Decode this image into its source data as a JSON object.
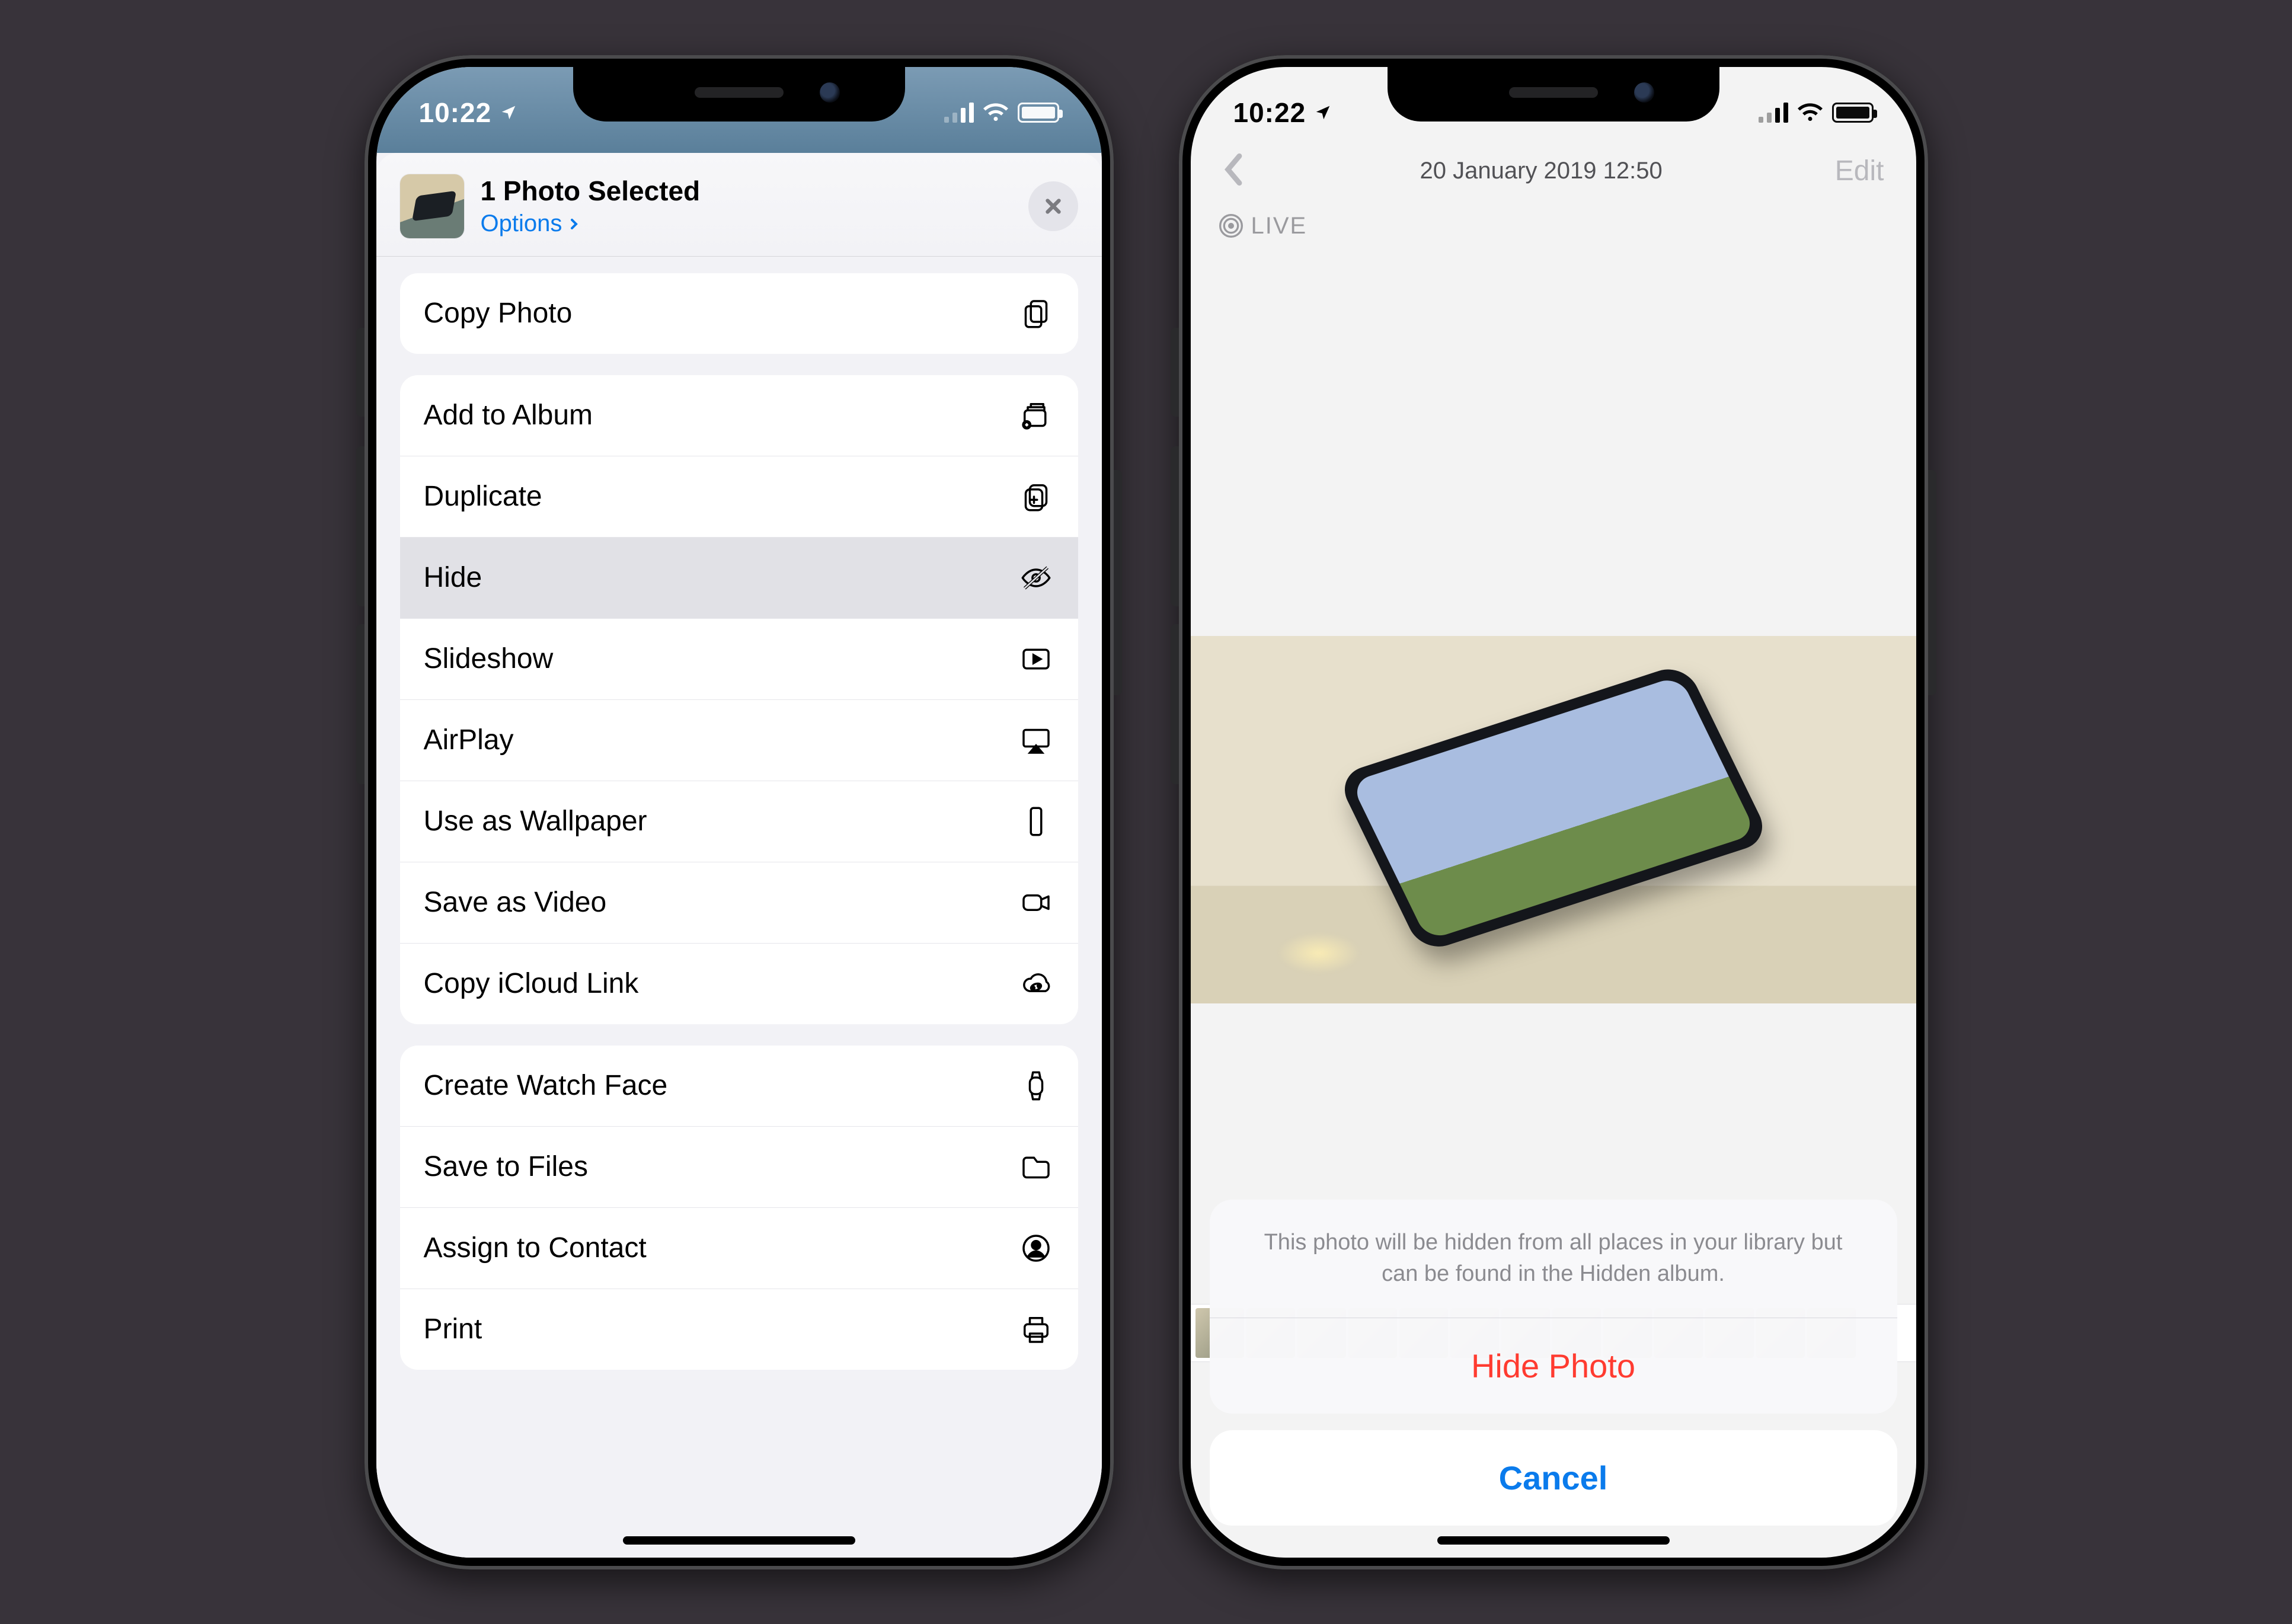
{
  "status": {
    "time": "10:22"
  },
  "share": {
    "title": "1 Photo Selected",
    "options": "Options",
    "groups": [
      [
        {
          "name": "copy-photo",
          "label": "Copy Photo",
          "icon": "copy",
          "pressed": false
        }
      ],
      [
        {
          "name": "add-album",
          "label": "Add to Album",
          "icon": "album",
          "pressed": false
        },
        {
          "name": "duplicate",
          "label": "Duplicate",
          "icon": "dup",
          "pressed": false
        },
        {
          "name": "hide",
          "label": "Hide",
          "icon": "eyeoff",
          "pressed": true
        },
        {
          "name": "slideshow",
          "label": "Slideshow",
          "icon": "play",
          "pressed": false
        },
        {
          "name": "airplay",
          "label": "AirPlay",
          "icon": "airplay",
          "pressed": false
        },
        {
          "name": "wallpaper",
          "label": "Use as Wallpaper",
          "icon": "phone",
          "pressed": false
        },
        {
          "name": "save-video",
          "label": "Save as Video",
          "icon": "video",
          "pressed": false
        },
        {
          "name": "icloud-link",
          "label": "Copy iCloud Link",
          "icon": "cloud",
          "pressed": false
        }
      ],
      [
        {
          "name": "watch-face",
          "label": "Create Watch Face",
          "icon": "watch",
          "pressed": false
        },
        {
          "name": "save-files",
          "label": "Save to Files",
          "icon": "folder",
          "pressed": false
        },
        {
          "name": "assign",
          "label": "Assign to Contact",
          "icon": "contact",
          "pressed": false
        },
        {
          "name": "print",
          "label": "Print",
          "icon": "printer",
          "pressed": false
        }
      ]
    ]
  },
  "photoView": {
    "dateTitle": "20 January 2019  12:50",
    "edit": "Edit",
    "live": "LIVE"
  },
  "actionSheet": {
    "message": "This photo will be hidden from all places in your library but can be found in the Hidden album.",
    "destructive": "Hide Photo",
    "cancel": "Cancel"
  }
}
